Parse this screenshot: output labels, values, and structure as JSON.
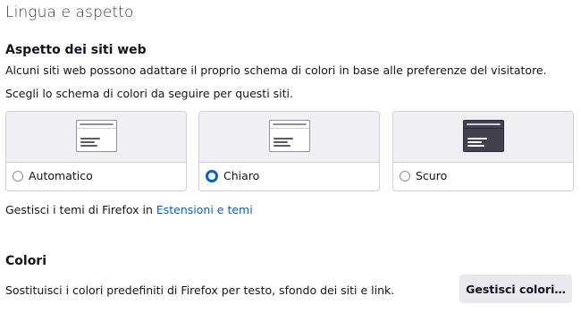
{
  "page": {
    "heading": "Lingua e aspetto"
  },
  "websites": {
    "title": "Aspetto dei siti web",
    "description": "Alcuni siti web possono adattare il proprio schema di colori in base alle preferenze del visitatore. Scegli lo schema di colori da seguire per questi siti.",
    "options": [
      {
        "label": "Automatico",
        "selected": false,
        "preview": "light"
      },
      {
        "label": "Chiaro",
        "selected": true,
        "preview": "light"
      },
      {
        "label": "Scuro",
        "selected": false,
        "preview": "dark"
      }
    ],
    "themes_text": "Gestisci i temi di Firefox in ",
    "themes_link": "Estensioni e temi"
  },
  "colors": {
    "title": "Colori",
    "description": "Sostituisci i colori predefiniti di Firefox per testo, sfondo dei siti e link.",
    "button_label": "Gestisci colori…"
  },
  "theme_colors": {
    "accent": "#0061e0",
    "text": "#15141a",
    "border": "#cfcfd8",
    "button_bg": "#e9e9ed"
  }
}
